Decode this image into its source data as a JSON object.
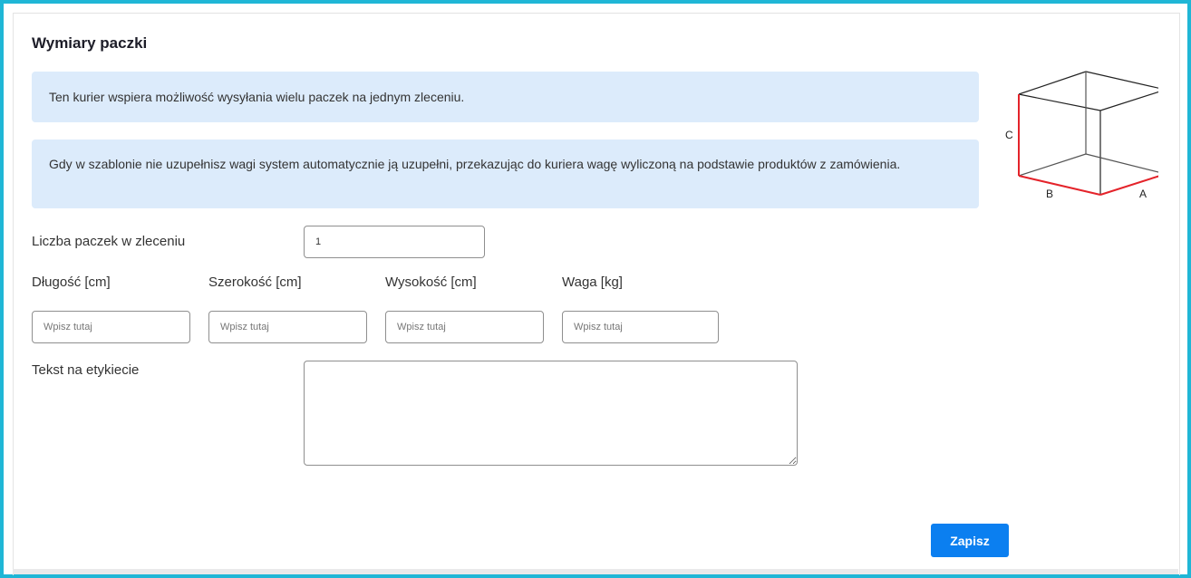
{
  "section": {
    "title": "Wymiary paczki"
  },
  "info": {
    "multi_package": "Ten kurier wspiera możliwość wysyłania wielu paczek na jednym zleceniu.",
    "weight_note": "Gdy w szablonie nie uzupełnisz wagi system automatycznie ją uzupełni, przekazując do kuriera wagę wyliczoną na podstawie produktów z zamówienia."
  },
  "form": {
    "package_count_label": "Liczba paczek w zleceniu",
    "package_count_value": "1",
    "length_label": "Długość [cm]",
    "width_label": "Szerokość [cm]",
    "height_label": "Wysokość [cm]",
    "weight_label": "Waga [kg]",
    "dimension_placeholder": "Wpisz tutaj",
    "label_text_label": "Tekst na etykiecie",
    "label_text_value": ""
  },
  "diagram": {
    "a": "A",
    "b": "B",
    "c": "C",
    "highlight_color": "#e4232a"
  },
  "actions": {
    "save_label": "Zapisz"
  },
  "colors": {
    "accent": "#0b7ff0",
    "frame": "#1fb6d6",
    "info_bg": "#dcebfb"
  }
}
